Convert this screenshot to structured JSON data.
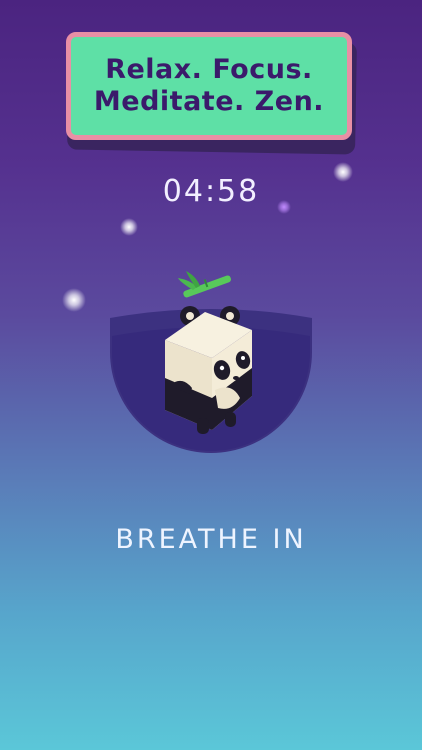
{
  "banner": {
    "line1": "Relax. Focus.",
    "line2": "Meditate. Zen."
  },
  "timer": "04:58",
  "breath_prompt": "BREATHE IN",
  "colors": {
    "banner_fill": "#5ee0a6",
    "banner_border": "#e88fa5",
    "banner_text": "#3b1a6b",
    "bowl": "#3c3180",
    "bamboo": "#58c95a"
  },
  "icons": [
    "panda-character",
    "bamboo-leaf-icon",
    "sparkle-icon"
  ]
}
